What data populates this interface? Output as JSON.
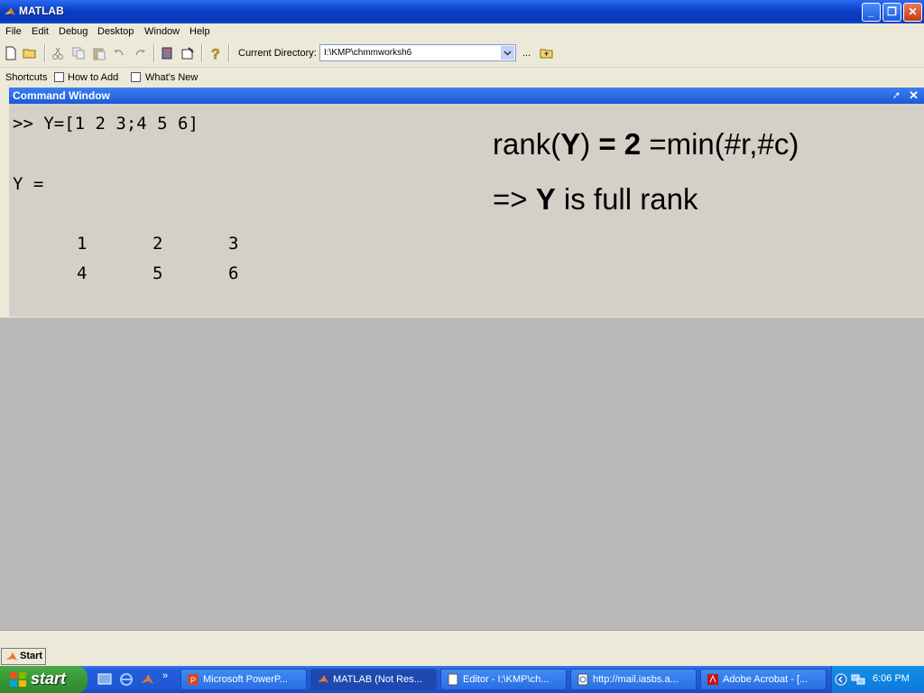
{
  "window": {
    "title": "MATLAB"
  },
  "menu": [
    "File",
    "Edit",
    "Debug",
    "Desktop",
    "Window",
    "Help"
  ],
  "toolbar": {
    "current_directory_label": "Current Directory:",
    "current_directory_value": "I:\\KMP\\chmmworksh6",
    "browse_label": "..."
  },
  "shortcuts": {
    "label": "Shortcuts",
    "how_to_add": "How to Add",
    "whats_new": "What's New"
  },
  "command_window": {
    "title": "Command Window",
    "prompt_line": ">> Y=[1 2 3;4 5 6]",
    "output_label": "Y =",
    "matrix": [
      [
        "1",
        "2",
        "3"
      ],
      [
        "4",
        "5",
        "6"
      ]
    ]
  },
  "annotation": {
    "line1_a": "rank(",
    "line1_b": "Y",
    "line1_c": ")",
    "line1_d": " = 2",
    "line1_e": " =min(#r,#c)",
    "line2_a": "=> ",
    "line2_b": "Y",
    "line2_c": " is full rank"
  },
  "start_small": "Start",
  "taskbar": {
    "start": "start",
    "tasks": [
      "Microsoft PowerP...",
      "MATLAB (Not Res...",
      "Editor - I:\\KMP\\ch...",
      "http://mail.iasbs.a...",
      "Adobe Acrobat - [..."
    ],
    "clock": "6:06 PM"
  }
}
